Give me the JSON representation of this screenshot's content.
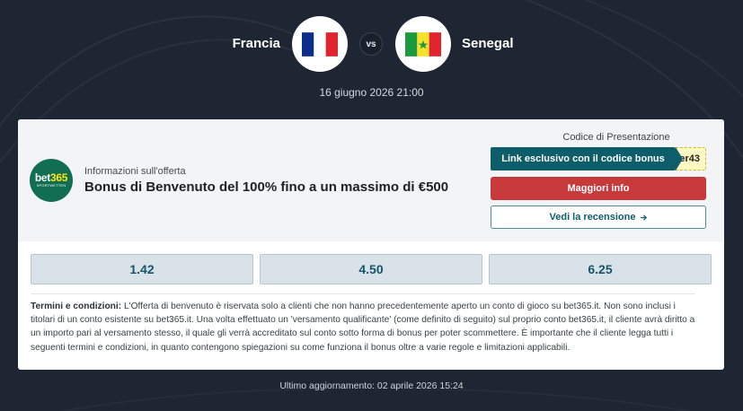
{
  "match": {
    "home_team": "Francia",
    "away_team": "Senegal",
    "vs_label": "vs",
    "date": "16 giugno 2026 21:00"
  },
  "offer": {
    "bookmaker_logo": {
      "main": "bet",
      "accent": "365",
      "sub": "SPORTWETTEN"
    },
    "info_label": "Informazioni sull'offerta",
    "title": "Bonus di Benvenuto del 100% fino a un massimo di €500",
    "promo_code_label": "Codice di Presentazione",
    "code_button_label": "Link esclusivo con il codice bonus",
    "code_partial": "er43",
    "more_info_label": "Maggiori info",
    "review_label": "Vedi la recensione",
    "colors": {
      "primary": "#0e5d6a",
      "danger": "#c7393a",
      "logo_bg": "#126e51",
      "logo_accent": "#ffe418"
    }
  },
  "odds": [
    "1.42",
    "4.50",
    "6.25"
  ],
  "terms": {
    "heading": "Termini e condizioni:",
    "text": " L'Offerta di benvenuto è riservata solo a clienti che non hanno precedentemente aperto un conto di gioco su bet365.it. Non sono inclusi i titolari di un conto esistente su bet365.it. Una volta effettuato un 'versamento qualificante' (come definito di seguito) sul proprio conto bet365.it, il cliente avrà diritto a un importo pari al versamento stesso, il quale gli verrà accreditato sul conto sotto forma di bonus per poter scommettere. È importante che il cliente legga tutti i seguenti termini e condizioni, in quanto contengono spiegazioni su come funziona il bonus oltre a varie regole e limitazioni applicabili."
  },
  "footer": {
    "last_updated": "Ultimo aggiornamento: 02 aprile 2026 15:24"
  }
}
